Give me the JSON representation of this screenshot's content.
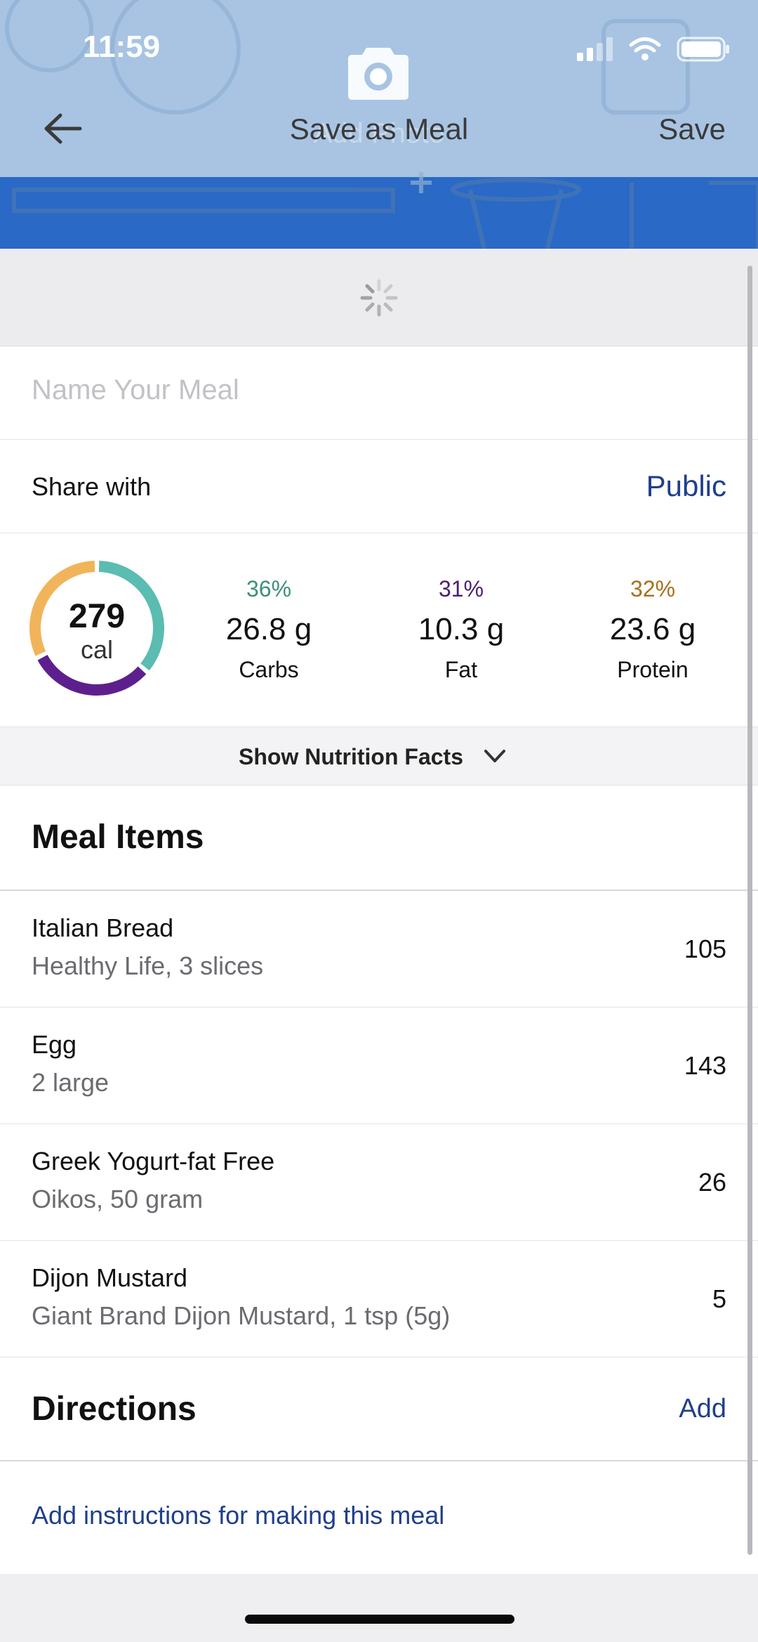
{
  "status_bar": {
    "time": "11:59",
    "icons": [
      "cellular-signal-icon",
      "wifi-icon",
      "battery-icon"
    ]
  },
  "header": {
    "camera_icon": "camera-icon",
    "add_photo_label": "Add Photo",
    "back_icon": "back-arrow-icon",
    "title": "Save as Meal",
    "save_label": "Save"
  },
  "loading": {
    "icon": "spinner-icon"
  },
  "meal_name": {
    "placeholder": "Name Your Meal",
    "value": ""
  },
  "share": {
    "label": "Share with",
    "value": "Public"
  },
  "nutrition_summary": {
    "calories": "279",
    "calories_unit": "cal",
    "ring": [
      {
        "name": "Carbs",
        "fraction": 0.36,
        "color": "#5bbcb2"
      },
      {
        "name": "Fat",
        "fraction": 0.31,
        "color": "#5e1f8e"
      },
      {
        "name": "Protein",
        "fraction": 0.32,
        "color": "#f1b45a"
      }
    ],
    "macros": [
      {
        "percent": "36%",
        "value": "26.8 g",
        "label": "Carbs",
        "color": "#3e8f7a"
      },
      {
        "percent": "31%",
        "value": "10.3 g",
        "label": "Fat",
        "color": "#4b1f6f"
      },
      {
        "percent": "32%",
        "value": "23.6 g",
        "label": "Protein",
        "color": "#a8701c"
      }
    ]
  },
  "nutrition_toggle": {
    "label": "Show Nutrition Facts",
    "icon": "chevron-down-icon"
  },
  "meal_items": {
    "title": "Meal Items",
    "items": [
      {
        "name": "Italian Bread",
        "desc": "Healthy Life, 3 slices",
        "calories": "105"
      },
      {
        "name": "Egg",
        "desc": "2 large",
        "calories": "143"
      },
      {
        "name": "Greek Yogurt-fat Free",
        "desc": "Oikos, 50 gram",
        "calories": "26"
      },
      {
        "name": "Dijon Mustard",
        "desc": "Giant Brand Dijon Mustard, 1 tsp (5g)",
        "calories": "5"
      }
    ]
  },
  "directions": {
    "title": "Directions",
    "add_label": "Add",
    "link": "Add instructions for making this meal"
  },
  "colors": {
    "header_bg": "#a8c4e2",
    "header_band": "#2a69c5",
    "link": "#1f3f8a"
  }
}
